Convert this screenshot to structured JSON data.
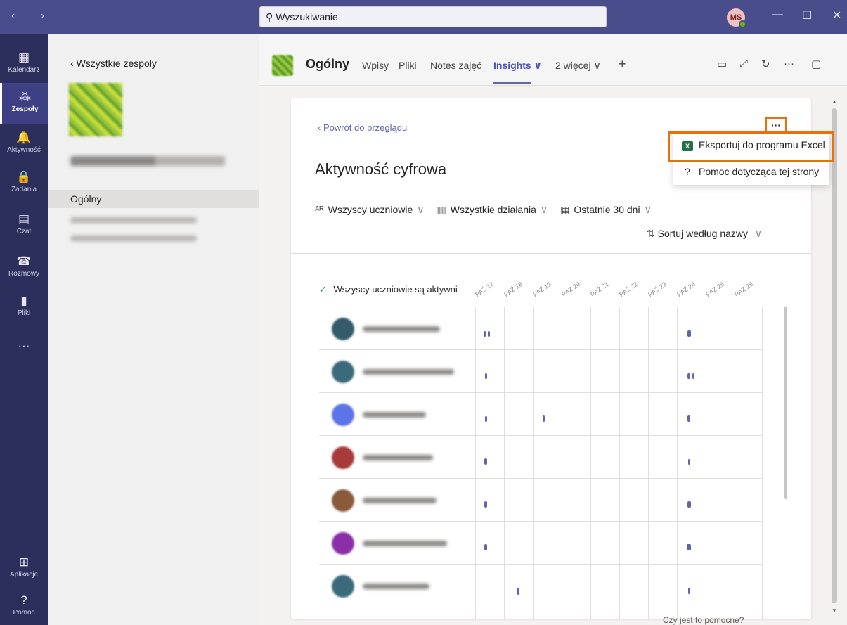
{
  "titlebar": {
    "search_placeholder": "Wyszukiwanie",
    "avatar_initials": "MS",
    "nav_arrows": "‹ ›",
    "min": "—",
    "max": "☐",
    "close": "✕"
  },
  "rail": {
    "items": [
      {
        "label": "Kalendarz",
        "icon": "▦"
      },
      {
        "label": "Zespoły",
        "icon": "⁂"
      },
      {
        "label": "Aktywność",
        "icon": "🔔"
      },
      {
        "label": "Zadania",
        "icon": "🔒"
      },
      {
        "label": "Czat",
        "icon": "▤"
      },
      {
        "label": "Rozmowy",
        "icon": "☎"
      },
      {
        "label": "Pliki",
        "icon": "▮"
      },
      {
        "label": "",
        "icon": "···"
      }
    ],
    "bottom": [
      {
        "label": "Aplikacje",
        "icon": "⊞"
      },
      {
        "label": "Pomoc",
        "icon": "?"
      }
    ]
  },
  "teampanel": {
    "back_label": "Wszystkie zespoły",
    "channel_active": "Ogólny"
  },
  "header": {
    "channel_title": "Ogólny",
    "tabs": [
      {
        "label": "Wpisy"
      },
      {
        "label": "Pliki"
      },
      {
        "label": "Notes zajęć"
      },
      {
        "label": "Insights ∨"
      },
      {
        "label": "2 więcej ∨"
      }
    ],
    "add_tab": "+"
  },
  "card": {
    "back_link": "Powrót do przeglądu",
    "title": "Aktywność cyfrowa",
    "filters": [
      {
        "icon": "ᴬᴿ",
        "label": "Wszyscy uczniowie"
      },
      {
        "icon": "▥",
        "label": "Wszystkie działania"
      },
      {
        "icon": "▦",
        "label": "Ostatnie 30 dni"
      }
    ],
    "sort_label": "Sortuj według nazwy",
    "more": "···",
    "grid_header": "Wszyscy uczniowie są aktywni",
    "dates": [
      "PAŹ 17",
      "PAŹ 18",
      "PAŹ 19",
      "PAŹ 20",
      "PAŹ 21",
      "PAŹ 22",
      "PAŹ 23",
      "PAŹ 24",
      "PAŹ 25",
      "PAŹ 25"
    ]
  },
  "menu": {
    "export": "Eksportuj do programu Excel",
    "help": "Pomoc dotycząca tej strony"
  },
  "footer": {
    "question": "Czy jest to pomocne?"
  },
  "colors": {
    "accent": "#6264a7",
    "rail": "#2c2f5b",
    "titlebar": "#4a4d8c",
    "highlight": "#e8710a"
  }
}
